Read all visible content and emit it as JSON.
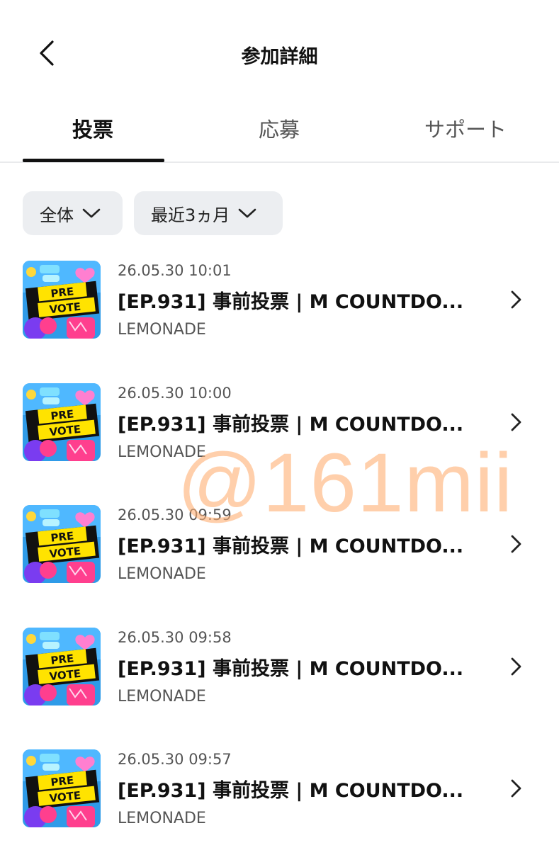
{
  "header": {
    "title": "参加詳細",
    "back_icon": "chevron-left-icon"
  },
  "tabs": [
    {
      "label": "投票",
      "active": true
    },
    {
      "label": "応募",
      "active": false
    },
    {
      "label": "サポート",
      "active": false
    }
  ],
  "filters": [
    {
      "label": "全体",
      "icon": "chevron-down-icon"
    },
    {
      "label": "最近3ヵ月",
      "icon": "chevron-down-icon"
    }
  ],
  "items": [
    {
      "date": "26.05.30 10:01",
      "title": "[EP.931] 事前投票 | M COUNTDO...",
      "subtitle": "LEMONADE",
      "thumb_line1": "PRE",
      "thumb_line2": "VOTE"
    },
    {
      "date": "26.05.30 10:00",
      "title": "[EP.931] 事前投票 | M COUNTDO...",
      "subtitle": "LEMONADE",
      "thumb_line1": "PRE",
      "thumb_line2": "VOTE"
    },
    {
      "date": "26.05.30 09:59",
      "title": "[EP.931] 事前投票 | M COUNTDO...",
      "subtitle": "LEMONADE",
      "thumb_line1": "PRE",
      "thumb_line2": "VOTE"
    },
    {
      "date": "26.05.30 09:58",
      "title": "[EP.931] 事前投票 | M COUNTDO...",
      "subtitle": "LEMONADE",
      "thumb_line1": "PRE",
      "thumb_line2": "VOTE"
    },
    {
      "date": "26.05.30 09:57",
      "title": "[EP.931] 事前投票 | M COUNTDO...",
      "subtitle": "LEMONADE",
      "thumb_line1": "PRE",
      "thumb_line2": "VOTE"
    }
  ],
  "watermark": "@161mii",
  "colors": {
    "accent": "#111111",
    "tab_inactive": "#555555",
    "filter_bg": "#eceef1",
    "thumb_blue": "#2f9be8",
    "thumb_yellow": "#ffe300",
    "thumb_pink": "#ff3f8e",
    "thumb_purple": "#7a3cf0",
    "watermark": "#ffaf73"
  }
}
